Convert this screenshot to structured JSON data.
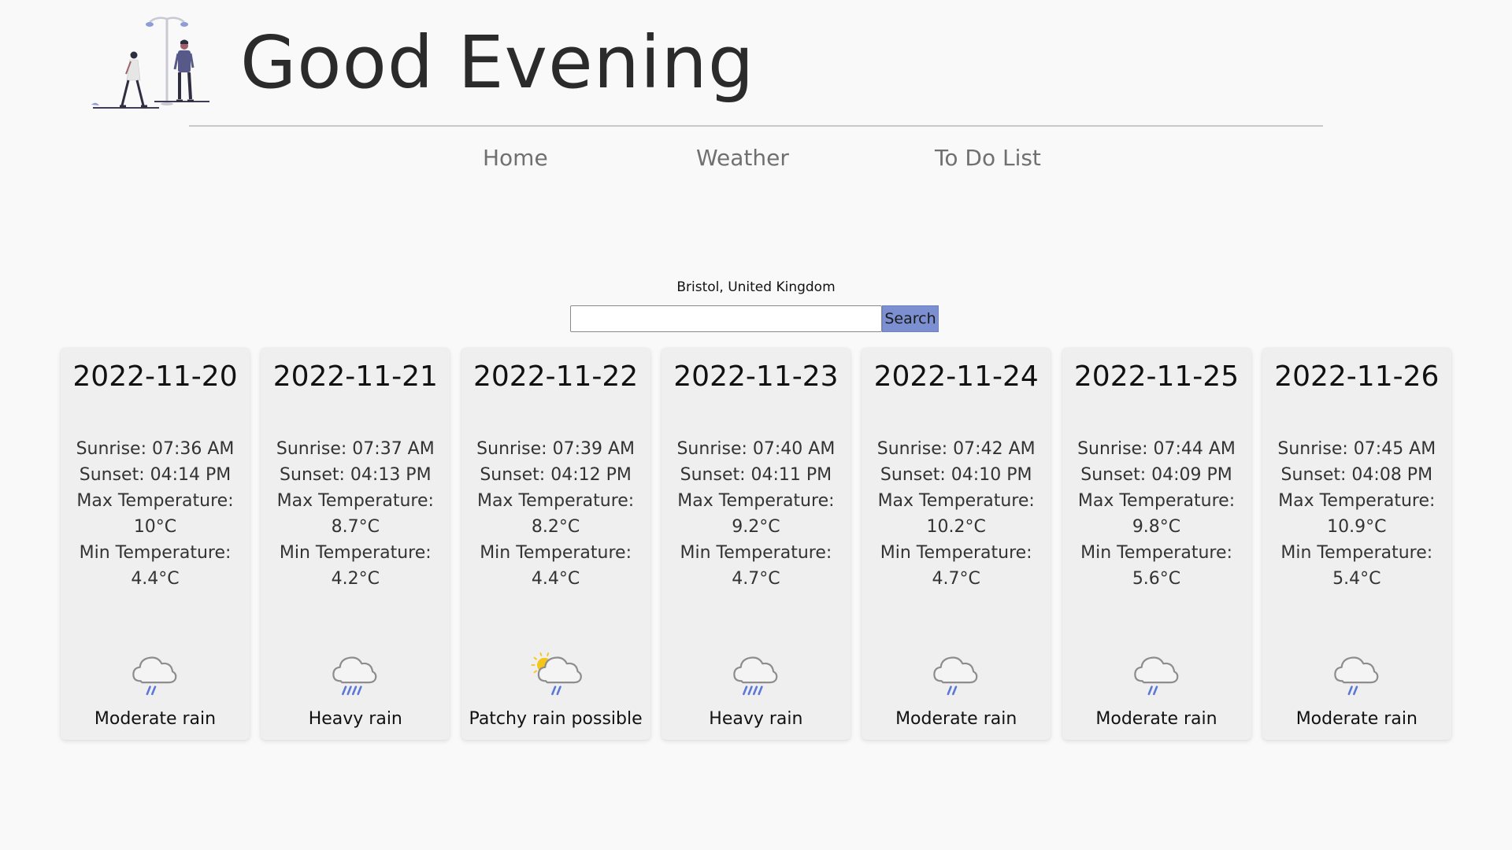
{
  "header": {
    "greeting": "Good Evening"
  },
  "nav": {
    "home": "Home",
    "weather": "Weather",
    "todo": "To Do List"
  },
  "search": {
    "location": "Bristol, United Kingdom",
    "value": "",
    "placeholder": "",
    "button_label": "Search",
    "button_color": "#7b8fd1"
  },
  "forecast": [
    {
      "date": "2022-11-20",
      "sunrise": "Sunrise: 07:36 AM",
      "sunset": "Sunset: 04:14 PM",
      "max_label": "Max Temperature:",
      "max_value": "10°C",
      "min_label": "Min Temperature:",
      "min_value": "4.4°C",
      "condition": "Moderate rain",
      "icon": "cloud-moderate-rain-icon"
    },
    {
      "date": "2022-11-21",
      "sunrise": "Sunrise: 07:37 AM",
      "sunset": "Sunset: 04:13 PM",
      "max_label": "Max Temperature:",
      "max_value": "8.7°C",
      "min_label": "Min Temperature:",
      "min_value": "4.2°C",
      "condition": "Heavy rain",
      "icon": "cloud-heavy-rain-icon"
    },
    {
      "date": "2022-11-22",
      "sunrise": "Sunrise: 07:39 AM",
      "sunset": "Sunset: 04:12 PM",
      "max_label": "Max Temperature:",
      "max_value": "8.2°C",
      "min_label": "Min Temperature:",
      "min_value": "4.4°C",
      "condition": "Patchy rain possible",
      "icon": "sun-cloud-rain-icon"
    },
    {
      "date": "2022-11-23",
      "sunrise": "Sunrise: 07:40 AM",
      "sunset": "Sunset: 04:11 PM",
      "max_label": "Max Temperature:",
      "max_value": "9.2°C",
      "min_label": "Min Temperature:",
      "min_value": "4.7°C",
      "condition": "Heavy rain",
      "icon": "cloud-heavy-rain-icon"
    },
    {
      "date": "2022-11-24",
      "sunrise": "Sunrise: 07:42 AM",
      "sunset": "Sunset: 04:10 PM",
      "max_label": "Max Temperature:",
      "max_value": "10.2°C",
      "min_label": "Min Temperature:",
      "min_value": "4.7°C",
      "condition": "Moderate rain",
      "icon": "cloud-moderate-rain-icon"
    },
    {
      "date": "2022-11-25",
      "sunrise": "Sunrise: 07:44 AM",
      "sunset": "Sunset: 04:09 PM",
      "max_label": "Max Temperature:",
      "max_value": "9.8°C",
      "min_label": "Min Temperature:",
      "min_value": "5.6°C",
      "condition": "Moderate rain",
      "icon": "cloud-moderate-rain-icon"
    },
    {
      "date": "2022-11-26",
      "sunrise": "Sunrise: 07:45 AM",
      "sunset": "Sunset: 04:08 PM",
      "max_label": "Max Temperature:",
      "max_value": "10.9°C",
      "min_label": "Min Temperature:",
      "min_value": "5.4°C",
      "condition": "Moderate rain",
      "icon": "cloud-moderate-rain-icon"
    }
  ]
}
